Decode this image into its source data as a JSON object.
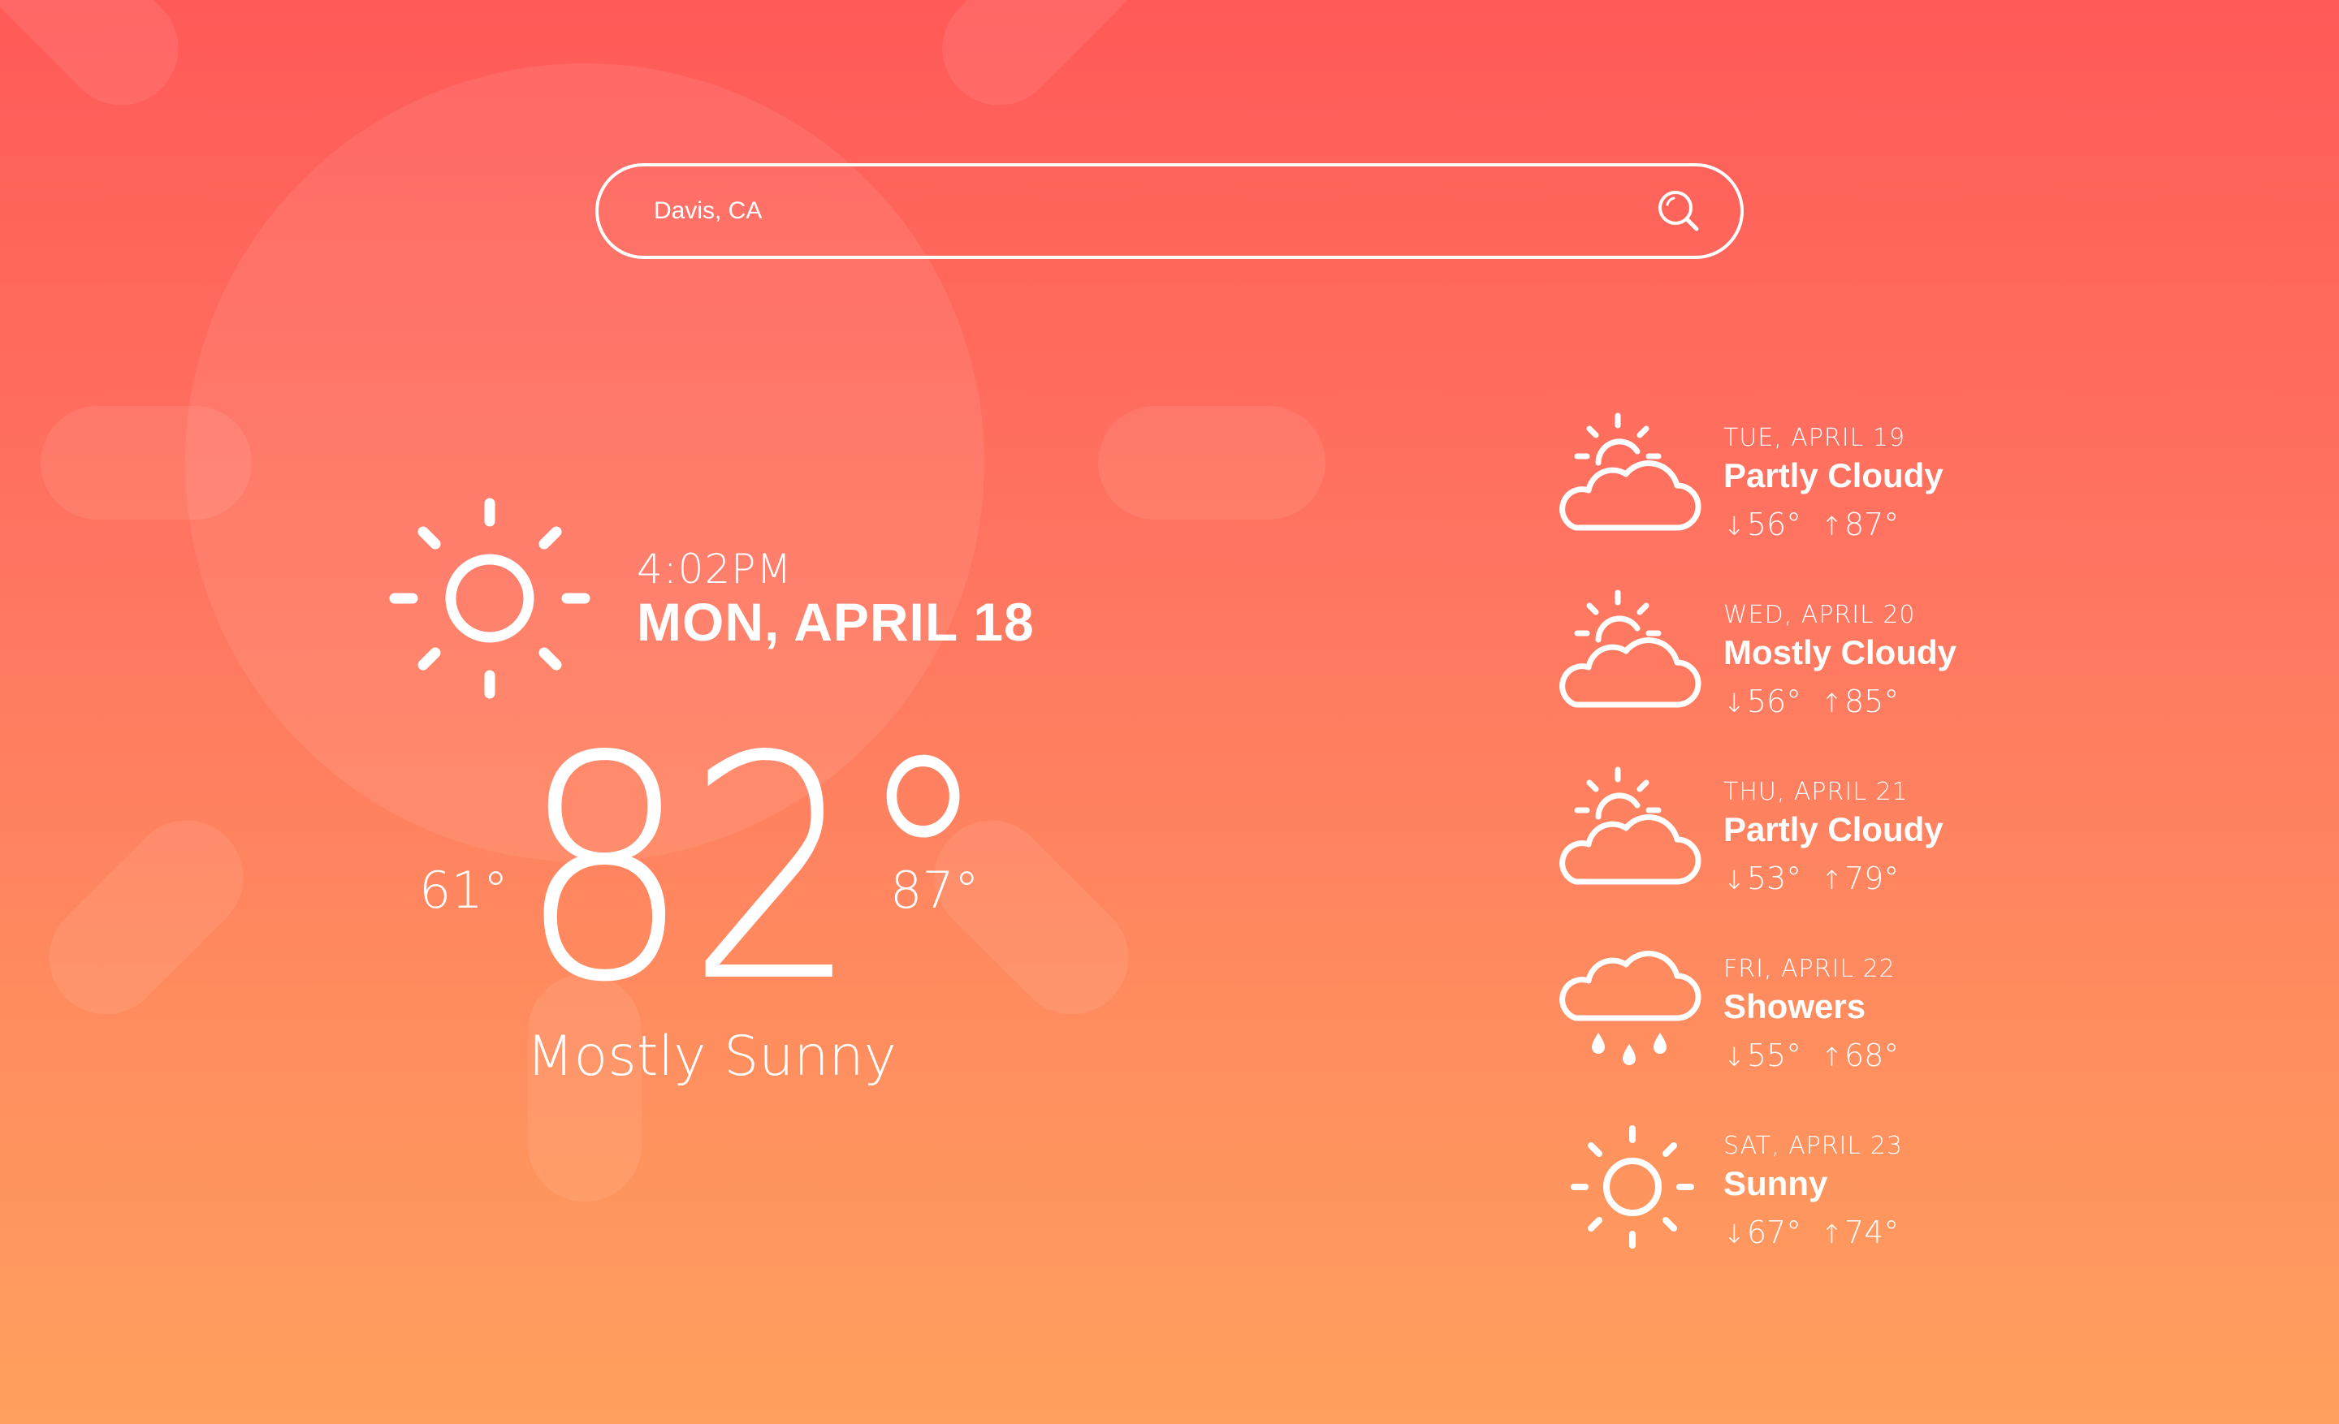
{
  "search": {
    "value": "Davis, CA",
    "placeholder": "Davis, CA",
    "icon": "search-icon"
  },
  "current": {
    "icon": "sun-icon",
    "time": "4:02PM",
    "date": "MON, APRIL 18",
    "temperature": "82°",
    "low": "61°",
    "high": "87°",
    "condition": "Mostly Sunny"
  },
  "forecast": [
    {
      "day": "TUE, APRIL 19",
      "condition": "Partly Cloudy",
      "low": "56°",
      "high": "87°",
      "icon": "partly-cloudy-icon",
      "low_arrow": "↓",
      "high_arrow": "↑"
    },
    {
      "day": "WED, APRIL 20",
      "condition": "Mostly Cloudy",
      "low": "56°",
      "high": "85°",
      "icon": "mostly-cloudy-icon",
      "low_arrow": "↓",
      "high_arrow": "↑"
    },
    {
      "day": "THU, APRIL 21",
      "condition": "Partly Cloudy",
      "low": "53°",
      "high": "79°",
      "icon": "partly-cloudy-icon",
      "low_arrow": "↓",
      "high_arrow": "↑"
    },
    {
      "day": "FRI, APRIL 22",
      "condition": "Showers",
      "low": "55°",
      "high": "68°",
      "icon": "rain-icon",
      "low_arrow": "↓",
      "high_arrow": "↑"
    },
    {
      "day": "SAT, APRIL 23",
      "condition": "Sunny",
      "low": "67°",
      "high": "74°",
      "icon": "sun-icon",
      "low_arrow": "↓",
      "high_arrow": "↑"
    }
  ],
  "colors": {
    "gradient_top": "#ff5a58",
    "gradient_bottom": "#ffa05d",
    "foreground": "#ffffff"
  }
}
